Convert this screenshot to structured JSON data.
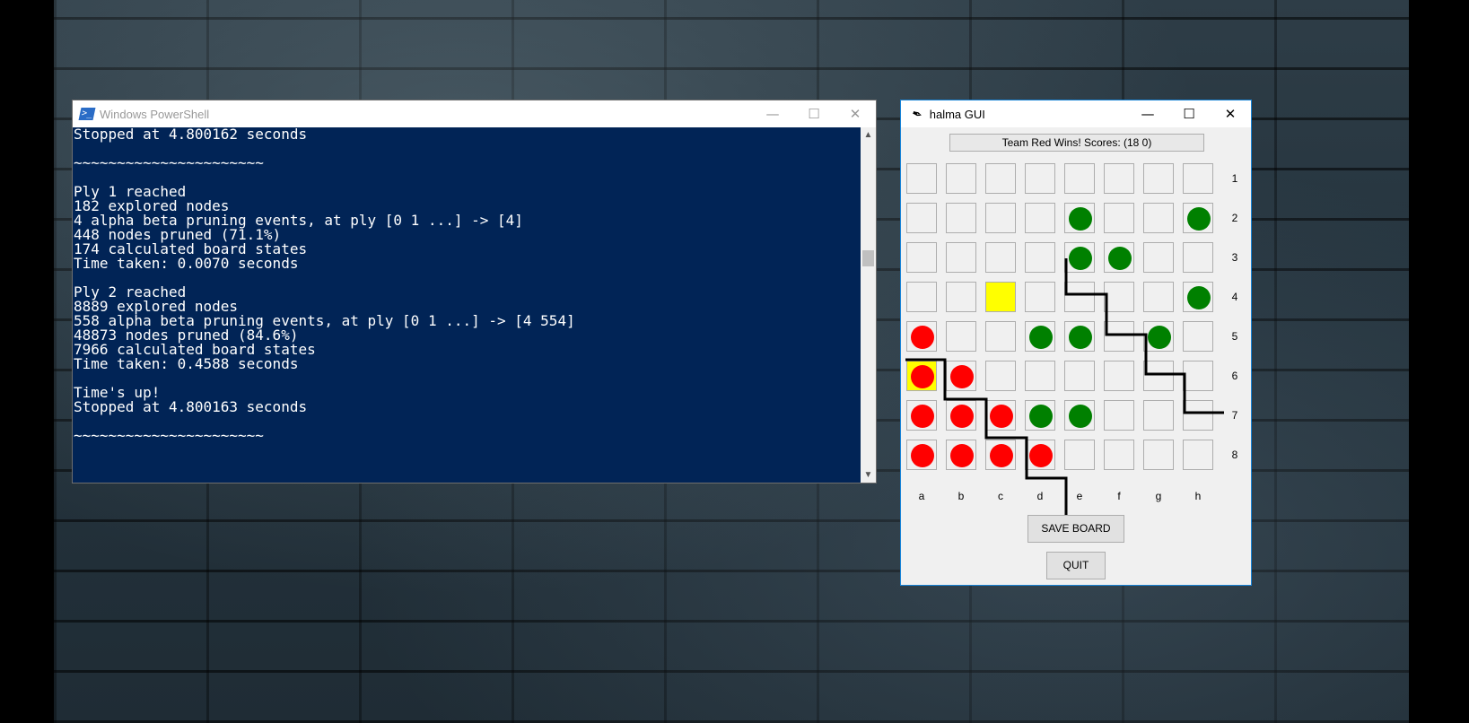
{
  "powershell": {
    "title": "Windows PowerShell",
    "lines": [
      "Stopped at 4.800162 seconds",
      "",
      "~~~~~~~~~~~~~~~~~~~~~~",
      "",
      "Ply 1 reached",
      "182 explored nodes",
      "4 alpha beta pruning events, at ply [0 1 ...] -> [4]",
      "448 nodes pruned (71.1%)",
      "174 calculated board states",
      "Time taken: 0.0070 seconds",
      "",
      "Ply 2 reached",
      "8889 explored nodes",
      "558 alpha beta pruning events, at ply [0 1 ...] -> [4 554]",
      "48873 nodes pruned (84.6%)",
      "7966 calculated board states",
      "Time taken: 0.4588 seconds",
      "",
      "Time's up!",
      "Stopped at 4.800163 seconds",
      "",
      "~~~~~~~~~~~~~~~~~~~~~~"
    ],
    "background": "#012456"
  },
  "halma": {
    "title": "halma GUI",
    "status": "Team Red Wins! Scores: (18 0)",
    "columns": [
      "a",
      "b",
      "c",
      "d",
      "e",
      "f",
      "g",
      "h"
    ],
    "rows": [
      "1",
      "2",
      "3",
      "4",
      "5",
      "6",
      "7",
      "8"
    ],
    "board": [
      [
        ".",
        ".",
        ".",
        ".",
        ".",
        ".",
        ".",
        "."
      ],
      [
        ".",
        ".",
        ".",
        ".",
        "G",
        ".",
        ".",
        "G"
      ],
      [
        ".",
        ".",
        ".",
        ".",
        "G",
        "G",
        ".",
        "."
      ],
      [
        ".",
        ".",
        "Y",
        ".",
        ".",
        ".",
        ".",
        "G"
      ],
      [
        "R",
        ".",
        ".",
        "G",
        "G",
        ".",
        "G",
        "."
      ],
      [
        "RY",
        "R",
        ".",
        ".",
        ".",
        ".",
        ".",
        "."
      ],
      [
        "R",
        "R",
        "R",
        "G",
        "G",
        ".",
        ".",
        "."
      ],
      [
        "R",
        "R",
        "R",
        "R",
        ".",
        ".",
        ".",
        "."
      ]
    ],
    "colors": {
      "red": "#ff0000",
      "green": "#008000",
      "selected": "#ffff00"
    },
    "save_label": "SAVE BOARD",
    "quit_label": "QUIT"
  },
  "icons": {
    "minimize": "minimize-icon",
    "maximize": "maximize-icon",
    "close": "close-icon"
  }
}
